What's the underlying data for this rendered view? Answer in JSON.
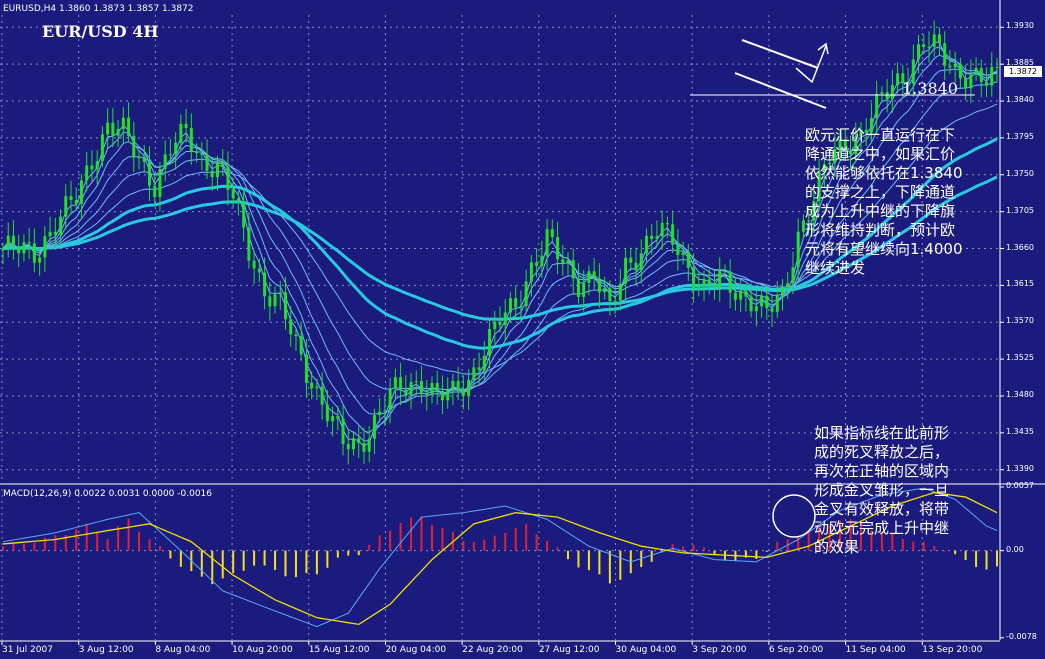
{
  "header": {
    "symbol_line": "EURUSD,H4  1.3860 1.3873 1.3857 1.3872",
    "macd_line": "MACD(12,26,9) 0.0022 0.0031 0.0000 -0.0016"
  },
  "title": "EUR/USD 4H",
  "current_price": "1.3872",
  "support_label": "1.3840",
  "annotation_top": [
    "欧元汇价一直运行在下",
    "降通道之中，如果汇价",
    "依然能够依托在1.3840",
    "的支撑之上，下降通道",
    "成为上升中继的下降旗",
    "形将维持判断，预计欧",
    "元将有望继续向1.4000",
    "继续进发"
  ],
  "annotation_bottom": [
    "如果指标线在此前形",
    "成的死叉释放之后，",
    "再次在正轴的区域内",
    "形成金叉雏形，一旦",
    "金叉有效释放，将带",
    "动欧元完成上升中继",
    "的效果"
  ],
  "colors": {
    "background": "#1b1b7e",
    "candle": "#22e022",
    "ma_thin": "#6fb8ff",
    "ma_thick": "#29c9e0",
    "macd_pos": "#e0203a",
    "macd_neg": "#f2e020",
    "signal": "#f0e000",
    "macd_line": "#5aa8ff"
  },
  "chart_data": {
    "type": "candlestick+macd",
    "price_axis_ticks": [
      "1.3930",
      "1.3885",
      "1.3840",
      "1.3795",
      "1.3750",
      "1.3705",
      "1.3660",
      "1.3615",
      "1.3570",
      "1.3525",
      "1.3480",
      "1.3435",
      "1.3390"
    ],
    "price_axis_range": [
      1.3375,
      1.3945
    ],
    "macd_axis_ticks": [
      "0.0057",
      "0.00",
      "-0.0078"
    ],
    "macd_axis_range": [
      -0.008,
      0.0057
    ],
    "x_tick_labels": [
      "31 Jul 2007",
      "3 Aug 12:00",
      "8 Aug 04:00",
      "10 Aug 20:00",
      "15 Aug 12:00",
      "20 Aug 04:00",
      "22 Aug 20:00",
      "27 Aug 12:00",
      "30 Aug 04:00",
      "3 Sep 20:00",
      "6 Sep 20:00",
      "11 Sep 04:00",
      "13 Sep 20:00"
    ],
    "close_path": [
      [
        0,
        1.366
      ],
      [
        6,
        1.3655
      ],
      [
        10,
        1.369
      ],
      [
        14,
        1.372
      ],
      [
        17,
        1.377
      ],
      [
        20,
        1.381
      ],
      [
        23,
        1.38
      ],
      [
        26,
        1.377
      ],
      [
        29,
        1.374
      ],
      [
        32,
        1.378
      ],
      [
        35,
        1.38
      ],
      [
        38,
        1.377
      ],
      [
        41,
        1.376
      ],
      [
        44,
        1.372
      ],
      [
        47,
        1.366
      ],
      [
        50,
        1.361
      ],
      [
        53,
        1.359
      ],
      [
        56,
        1.354
      ],
      [
        59,
        1.35
      ],
      [
        62,
        1.346
      ],
      [
        65,
        1.342
      ],
      [
        68,
        1.342
      ],
      [
        71,
        1.345
      ],
      [
        74,
        1.348
      ],
      [
        77,
        1.349
      ],
      [
        80,
        1.35
      ],
      [
        83,
        1.348
      ],
      [
        86,
        1.348
      ],
      [
        89,
        1.35
      ],
      [
        92,
        1.354
      ],
      [
        95,
        1.357
      ],
      [
        98,
        1.359
      ],
      [
        101,
        1.364
      ],
      [
        104,
        1.367
      ],
      [
        107,
        1.364
      ],
      [
        110,
        1.362
      ],
      [
        113,
        1.363
      ],
      [
        116,
        1.358
      ],
      [
        119,
        1.364
      ],
      [
        122,
        1.366
      ],
      [
        125,
        1.368
      ],
      [
        128,
        1.367
      ],
      [
        131,
        1.364
      ],
      [
        134,
        1.361
      ],
      [
        137,
        1.362
      ],
      [
        140,
        1.361
      ],
      [
        143,
        1.36
      ],
      [
        146,
        1.358
      ],
      [
        149,
        1.36
      ],
      [
        152,
        1.368
      ],
      [
        155,
        1.372
      ],
      [
        158,
        1.377
      ],
      [
        161,
        1.379
      ],
      [
        164,
        1.38
      ],
      [
        167,
        1.383
      ],
      [
        170,
        1.386
      ],
      [
        173,
        1.388
      ],
      [
        176,
        1.391
      ],
      [
        179,
        1.39
      ],
      [
        182,
        1.388
      ],
      [
        185,
        1.387
      ],
      [
        188,
        1.386
      ],
      [
        190,
        1.3872
      ]
    ],
    "macd_hist": [
      [
        0,
        0.0004
      ],
      [
        8,
        0.001
      ],
      [
        16,
        0.0022
      ],
      [
        20,
        0.0012
      ],
      [
        24,
        0.0028
      ],
      [
        28,
        0.001
      ],
      [
        32,
        -0.0006
      ],
      [
        36,
        -0.002
      ],
      [
        40,
        -0.0028
      ],
      [
        44,
        -0.0022
      ],
      [
        48,
        -0.0012
      ],
      [
        52,
        -0.0018
      ],
      [
        56,
        -0.0024
      ],
      [
        60,
        -0.002
      ],
      [
        64,
        -0.0008
      ],
      [
        68,
        -0.0002
      ],
      [
        72,
        0.0012
      ],
      [
        76,
        0.0026
      ],
      [
        80,
        0.003
      ],
      [
        84,
        0.002
      ],
      [
        88,
        0.001
      ],
      [
        92,
        0.0008
      ],
      [
        96,
        0.0018
      ],
      [
        100,
        0.0022
      ],
      [
        104,
        0.001
      ],
      [
        108,
        -0.0008
      ],
      [
        112,
        -0.0018
      ],
      [
        116,
        -0.0028
      ],
      [
        120,
        -0.0022
      ],
      [
        124,
        -0.0008
      ],
      [
        128,
        0.0004
      ],
      [
        132,
        0.0006
      ],
      [
        136,
        -0.0004
      ],
      [
        140,
        -0.001
      ],
      [
        144,
        -0.0006
      ],
      [
        148,
        0.0006
      ],
      [
        152,
        0.0014
      ],
      [
        156,
        0.002
      ],
      [
        160,
        0.0028
      ],
      [
        164,
        0.0024
      ],
      [
        168,
        0.0016
      ],
      [
        172,
        0.0012
      ],
      [
        176,
        0.0006
      ],
      [
        180,
        0.0002
      ],
      [
        184,
        -0.001
      ],
      [
        188,
        -0.0016
      ]
    ],
    "macd_line": [
      [
        0,
        0.0008
      ],
      [
        10,
        0.0016
      ],
      [
        20,
        0.0028
      ],
      [
        26,
        0.0034
      ],
      [
        34,
        0.0
      ],
      [
        42,
        -0.0036
      ],
      [
        52,
        -0.0054
      ],
      [
        60,
        -0.0068
      ],
      [
        66,
        -0.0056
      ],
      [
        72,
        -0.0016
      ],
      [
        80,
        0.003
      ],
      [
        88,
        0.0034
      ],
      [
        96,
        0.004
      ],
      [
        104,
        0.0028
      ],
      [
        112,
        0.0004
      ],
      [
        120,
        -0.001
      ],
      [
        128,
        0.0002
      ],
      [
        136,
        -0.0008
      ],
      [
        144,
        -0.001
      ],
      [
        152,
        0.001
      ],
      [
        160,
        0.0036
      ],
      [
        168,
        0.005
      ],
      [
        176,
        0.0056
      ],
      [
        182,
        0.0046
      ],
      [
        188,
        0.0022
      ],
      [
        190,
        0.0018
      ]
    ],
    "signal_line": [
      [
        0,
        0.0006
      ],
      [
        10,
        0.001
      ],
      [
        20,
        0.0018
      ],
      [
        28,
        0.0024
      ],
      [
        36,
        0.0008
      ],
      [
        44,
        -0.0022
      ],
      [
        52,
        -0.0044
      ],
      [
        60,
        -0.006
      ],
      [
        68,
        -0.0066
      ],
      [
        74,
        -0.0048
      ],
      [
        82,
        -0.0008
      ],
      [
        90,
        0.0024
      ],
      [
        98,
        0.0034
      ],
      [
        106,
        0.003
      ],
      [
        114,
        0.0016
      ],
      [
        122,
        0.0004
      ],
      [
        130,
        -0.0002
      ],
      [
        138,
        -0.0004
      ],
      [
        146,
        -0.0006
      ],
      [
        154,
        0.0004
      ],
      [
        162,
        0.0022
      ],
      [
        170,
        0.004
      ],
      [
        178,
        0.0052
      ],
      [
        184,
        0.0048
      ],
      [
        190,
        0.0034
      ]
    ]
  }
}
